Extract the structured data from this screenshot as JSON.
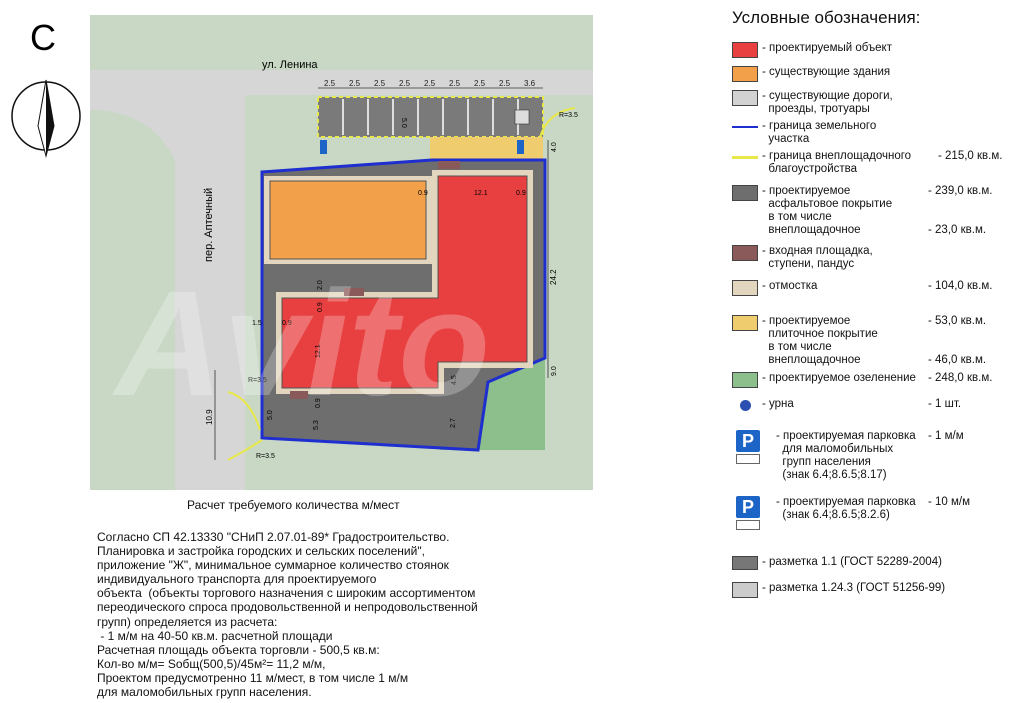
{
  "plan": {
    "compass_letter": "С",
    "street_top": "ул. Ленина",
    "street_left": "пер. Аптечный",
    "dims_top": [
      "2.5",
      "2.5",
      "2.5",
      "2.5",
      "2.5",
      "2.5",
      "2.5",
      "2.5",
      "3.6"
    ],
    "dim_labels": {
      "d1": "5.0",
      "d2": "2.0",
      "d3": "4.0",
      "d4": "24.2",
      "d5": "9.0",
      "d6": "12.1",
      "d7": "0.9",
      "d8": "0.9",
      "d9": "2.0",
      "d10": "0.9",
      "d11": "1.5",
      "d12": "0.9",
      "d13": "12.1",
      "d14": "0.9",
      "d15": "5.0",
      "d16": "5.3",
      "d17": "2.7",
      "d18": "10.9",
      "d19": "4.5"
    },
    "radii": [
      "R=3.5",
      "R=3.5",
      "R=3.5"
    ],
    "watermark": "Avito"
  },
  "legend": {
    "title": "Условные обозначения:",
    "items": [
      {
        "text": "- проектируемый объект",
        "value": "",
        "color": "#e84040"
      },
      {
        "text": "- существующие здания",
        "value": "",
        "color": "#f2a04a"
      },
      {
        "text": "- существующие дороги,\n  проезды, тротуары",
        "value": "",
        "color": "#d2d2d2"
      },
      {
        "text": "- граница земельного\n  участка",
        "value": "",
        "color": "#1f2fcf"
      },
      {
        "text": "- граница внеплощадочного\n  благоустройства",
        "value": "- 215,0 кв.м.",
        "color": "#e8e84a"
      },
      {
        "text": "- проектируемое\n  асфальтовое покрытие\n  в том числе\n  внеплощадочное",
        "value": "- 239,0 кв.м.\n\n\n- 23,0 кв.м.",
        "color": "#6e6e6e"
      },
      {
        "text": "- входная площадка,\n  ступени, пандус",
        "value": "",
        "color": "#8a5a5a"
      },
      {
        "text": "- отмостка",
        "value": "- 104,0 кв.м.",
        "color": "#e3d6bf"
      },
      {
        "text": "- проектируемое\n  плиточное покрытие\n  в том числе\n  внеплощадочное",
        "value": "- 53,0 кв.м.\n\n\n- 46,0 кв.м.",
        "color": "#efcd6e"
      },
      {
        "text": "- проектируемое озеленение",
        "value": "- 248,0 кв.м.",
        "color": "#8cbf8c"
      },
      {
        "text": "- урна",
        "value": "- 1 шт.",
        "color": "#2a4fb0"
      },
      {
        "text": "- проектируемая парковка\n  для маломобильных\n  групп населения\n  (знак 6.4;8.6.5;8.17)",
        "value": "- 1 м/м",
        "color": "#1c64c6"
      },
      {
        "text": "- проектируемая парковка\n  (знак 6.4;8.6.5;8.2.6)",
        "value": "- 10 м/м",
        "color": "#1c64c6"
      },
      {
        "text": "- разметка 1.1 (ГОСТ 52289-2004)",
        "value": "",
        "color": "#777777"
      },
      {
        "text": "- разметка 1.24.3 (ГОСТ 51256-99)",
        "value": "",
        "color": "#cccccc"
      }
    ],
    "parking_letter": "P"
  },
  "calc": {
    "title": "Расчет требуемого количества м/мест",
    "body": "Согласно СП 42.13330 \"СНиП 2.07.01-89* Градостроительство.\nПланировка и застройка городских и сельских поселений\",\nприложение \"Ж\", минимальное суммарное количество стоянок\nиндивидуального транспорта для проектируемого\nобъекта  (объекты торгового назначения с широким ассортиментом\nпереодического спроса продовольственной и непродовольственной\nгрупп) определяется из расчета:\n - 1 м/м на 40-50 кв.м. расчетной площади\nРасчетная площадь объекта торговли - 500,5 кв.м:\nКол-во м/м= Sобщ(500,5)/45м²= 11,2 м/м,\nПроектом предусмотренно 11 м/мест, в том числе 1 м/м\nдля маломобильных групп населения."
  }
}
